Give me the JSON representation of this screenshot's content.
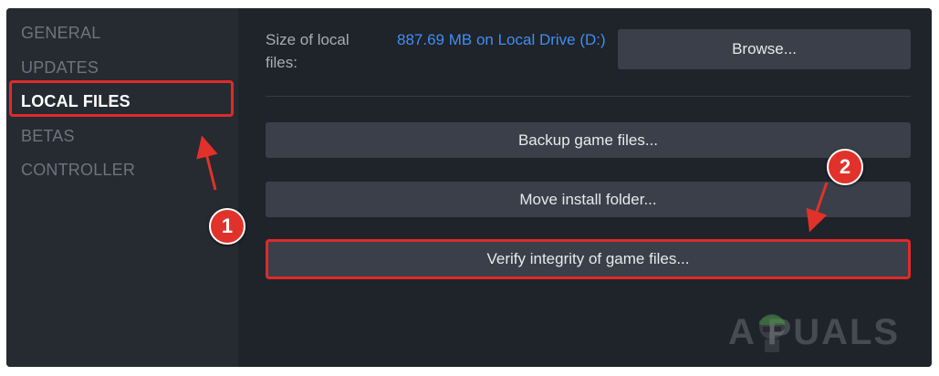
{
  "sidebar": {
    "items": [
      {
        "label": "GENERAL",
        "active": false
      },
      {
        "label": "UPDATES",
        "active": false
      },
      {
        "label": "LOCAL FILES",
        "active": true
      },
      {
        "label": "BETAS",
        "active": false
      },
      {
        "label": "CONTROLLER",
        "active": false
      }
    ]
  },
  "local_files": {
    "size_label": "Size of local files:",
    "size_value": "887.69 MB on Local Drive (D:)",
    "browse_label": "Browse...",
    "backup_label": "Backup game files...",
    "move_label": "Move install folder...",
    "verify_label": "Verify integrity of game files..."
  },
  "annotations": {
    "callout_1": "1",
    "callout_2": "2",
    "highlight_color": "#e02a2a"
  },
  "watermark": {
    "text": "A PUALS",
    "logo": "appuals-mascot-logo"
  },
  "colors": {
    "link_blue": "#3f8ff1",
    "sidebar_bg": "#262a31",
    "main_bg": "#1f232a",
    "button_bg": "#3a3f49"
  }
}
